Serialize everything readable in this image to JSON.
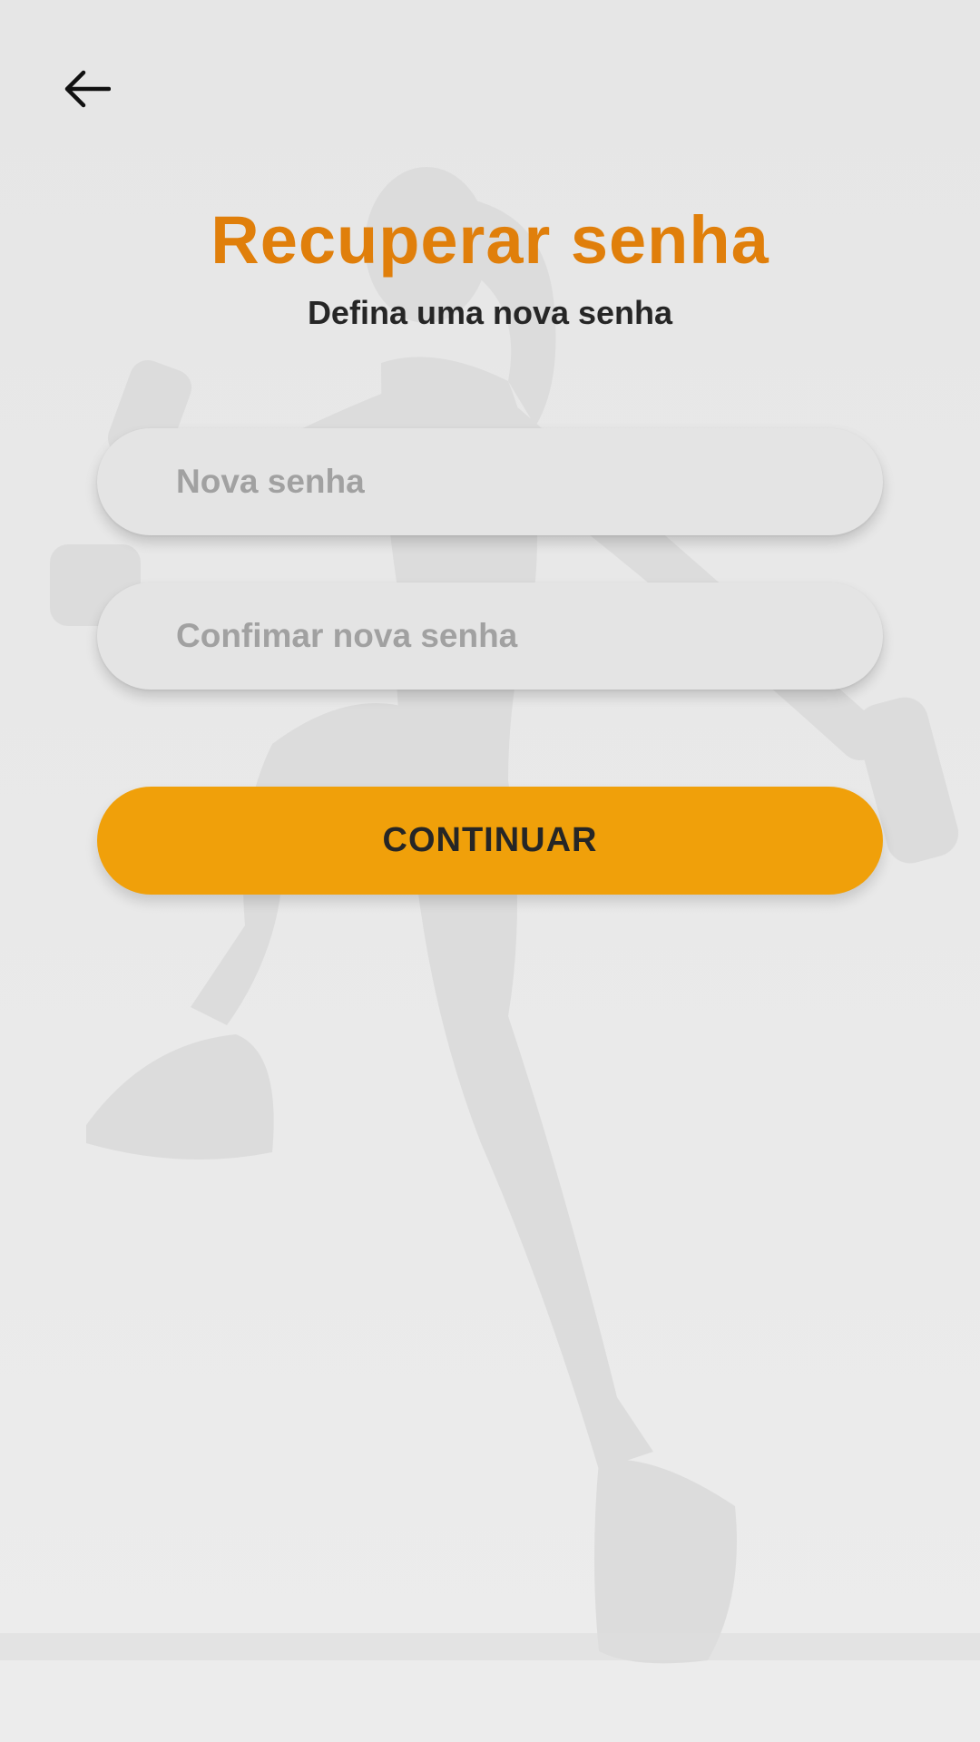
{
  "header": {
    "back_icon": "arrow-left-icon"
  },
  "title": "Recuperar senha",
  "subtitle": "Defina uma nova senha",
  "form": {
    "new_password": {
      "placeholder": "Nova senha",
      "value": ""
    },
    "confirm_password": {
      "placeholder": "Confimar nova senha",
      "value": ""
    },
    "continue_label": "CONTINUAR"
  },
  "colors": {
    "accent": "#f0a00a",
    "title": "#e07f0b",
    "background": "#e6e6e6",
    "text_dark": "#262626",
    "placeholder": "#a1a1a1"
  },
  "background_image": "faded-fitness-woman-with-dumbbells"
}
